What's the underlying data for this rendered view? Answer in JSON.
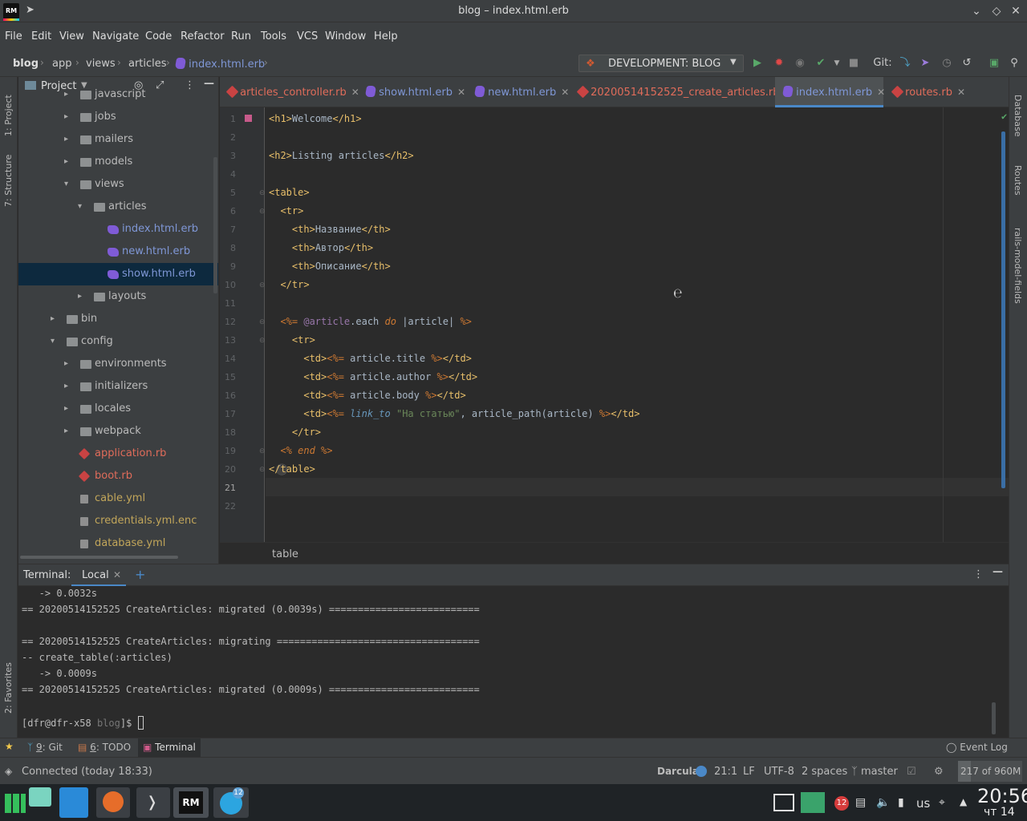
{
  "window": {
    "title": "blog – index.html.erb",
    "app_badge": "RM"
  },
  "menu": [
    "File",
    "Edit",
    "View",
    "Navigate",
    "Code",
    "Refactor",
    "Run",
    "Tools",
    "VCS",
    "Window",
    "Help"
  ],
  "nav": {
    "crumbs": [
      "blog",
      "app",
      "views",
      "articles",
      "index.html.erb"
    ],
    "run_config": "DEVELOPMENT: BLOG",
    "git_label": "Git:"
  },
  "left_stripe": {
    "project_tab": "1: Project",
    "structure_tab": "7: Structure",
    "favorites_tab": "2: Favorites"
  },
  "right_stripe": {
    "database_tab": "Database",
    "routes_tab": "Routes",
    "model_fields_tab": "rails-model-fields"
  },
  "project": {
    "title": "Project",
    "tree": [
      {
        "label": "javascript",
        "kind": "folder",
        "depth": 2,
        "expanded": false
      },
      {
        "label": "jobs",
        "kind": "folder",
        "depth": 2,
        "expanded": false
      },
      {
        "label": "mailers",
        "kind": "folder",
        "depth": 2,
        "expanded": false
      },
      {
        "label": "models",
        "kind": "folder",
        "depth": 2,
        "expanded": false
      },
      {
        "label": "views",
        "kind": "folder",
        "depth": 2,
        "expanded": true
      },
      {
        "label": "articles",
        "kind": "folder",
        "depth": 3,
        "expanded": true
      },
      {
        "label": "index.html.erb",
        "kind": "erb",
        "depth": 4
      },
      {
        "label": "new.html.erb",
        "kind": "erb",
        "depth": 4
      },
      {
        "label": "show.html.erb",
        "kind": "erb",
        "depth": 4,
        "selected": true
      },
      {
        "label": "layouts",
        "kind": "folder",
        "depth": 3,
        "expanded": false
      },
      {
        "label": "bin",
        "kind": "folder",
        "depth": 1,
        "expanded": false
      },
      {
        "label": "config",
        "kind": "folder",
        "depth": 1,
        "expanded": true
      },
      {
        "label": "environments",
        "kind": "folder",
        "depth": 2,
        "expanded": false
      },
      {
        "label": "initializers",
        "kind": "folder",
        "depth": 2,
        "expanded": false
      },
      {
        "label": "locales",
        "kind": "folder",
        "depth": 2,
        "expanded": false
      },
      {
        "label": "webpack",
        "kind": "folder",
        "depth": 2,
        "expanded": false
      },
      {
        "label": "application.rb",
        "kind": "rb",
        "depth": 2
      },
      {
        "label": "boot.rb",
        "kind": "rb",
        "depth": 2
      },
      {
        "label": "cable.yml",
        "kind": "yml",
        "depth": 2
      },
      {
        "label": "credentials.yml.enc",
        "kind": "enc",
        "depth": 2
      },
      {
        "label": "database.yml",
        "kind": "yml",
        "depth": 2
      }
    ]
  },
  "editor_tabs": [
    {
      "label": "articles_controller.rb",
      "kind": "rb"
    },
    {
      "label": "show.html.erb",
      "kind": "erb"
    },
    {
      "label": "new.html.erb",
      "kind": "erb"
    },
    {
      "label": "20200514152525_create_articles.rb",
      "kind": "rb"
    },
    {
      "label": "index.html.erb",
      "kind": "erb",
      "active": true
    },
    {
      "label": "routes.rb",
      "kind": "rb"
    }
  ],
  "editor": {
    "line_numbers": [
      "1",
      "2",
      "3",
      "4",
      "5",
      "6",
      "7",
      "8",
      "9",
      "10",
      "11",
      "12",
      "13",
      "14",
      "15",
      "16",
      "17",
      "18",
      "19",
      "20",
      "21",
      "22"
    ],
    "current_line": "21",
    "lines": [
      [
        [
          "tag",
          "<h1>"
        ],
        [
          "plain",
          "Welcome"
        ],
        [
          "tag",
          "</h1>"
        ]
      ],
      [],
      [
        [
          "tag",
          "<h2>"
        ],
        [
          "plain",
          "Listing articles"
        ],
        [
          "tag",
          "</h2>"
        ]
      ],
      [],
      [
        [
          "tag",
          "<table>"
        ]
      ],
      [
        [
          "plain",
          "  "
        ],
        [
          "tag",
          "<tr>"
        ]
      ],
      [
        [
          "plain",
          "    "
        ],
        [
          "tag",
          "<th>"
        ],
        [
          "plain",
          "Название"
        ],
        [
          "tag",
          "</th>"
        ]
      ],
      [
        [
          "plain",
          "    "
        ],
        [
          "tag",
          "<th>"
        ],
        [
          "plain",
          "Автор"
        ],
        [
          "tag",
          "</th>"
        ]
      ],
      [
        [
          "plain",
          "    "
        ],
        [
          "tag",
          "<th>"
        ],
        [
          "plain",
          "Описание"
        ],
        [
          "tag",
          "</th>"
        ]
      ],
      [
        [
          "plain",
          "  "
        ],
        [
          "tag",
          "</tr>"
        ]
      ],
      [],
      [
        [
          "plain",
          "  "
        ],
        [
          "erbd",
          "<%= "
        ],
        [
          "ivar",
          "@article"
        ],
        [
          "plain",
          ".each "
        ],
        [
          "kw",
          "do"
        ],
        [
          "plain",
          " |article| "
        ],
        [
          "erbd",
          "%>"
        ]
      ],
      [
        [
          "plain",
          "    "
        ],
        [
          "tag",
          "<tr>"
        ]
      ],
      [
        [
          "plain",
          "      "
        ],
        [
          "tag",
          "<td>"
        ],
        [
          "erbd",
          "<%= "
        ],
        [
          "plain",
          "article.title "
        ],
        [
          "erbd",
          "%>"
        ],
        [
          "tag",
          "</td>"
        ]
      ],
      [
        [
          "plain",
          "      "
        ],
        [
          "tag",
          "<td>"
        ],
        [
          "erbd",
          "<%= "
        ],
        [
          "plain",
          "article.author "
        ],
        [
          "erbd",
          "%>"
        ],
        [
          "tag",
          "</td>"
        ]
      ],
      [
        [
          "plain",
          "      "
        ],
        [
          "tag",
          "<td>"
        ],
        [
          "erbd",
          "<%= "
        ],
        [
          "plain",
          "article.body "
        ],
        [
          "erbd",
          "%>"
        ],
        [
          "tag",
          "</td>"
        ]
      ],
      [
        [
          "plain",
          "      "
        ],
        [
          "tag",
          "<td>"
        ],
        [
          "erbd",
          "<%= "
        ],
        [
          "fn",
          "link_to"
        ],
        [
          "plain",
          " "
        ],
        [
          "str",
          "\"На статью\""
        ],
        [
          "plain",
          ", article_path(article) "
        ],
        [
          "erbd",
          "%>"
        ],
        [
          "tag",
          "</td>"
        ]
      ],
      [
        [
          "plain",
          "    "
        ],
        [
          "tag",
          "</tr>"
        ]
      ],
      [
        [
          "plain",
          "  "
        ],
        [
          "erbd",
          "<% "
        ],
        [
          "kw",
          "end"
        ],
        [
          "erbd",
          " %>"
        ]
      ],
      [
        [
          "tag",
          "</table>"
        ]
      ],
      [],
      []
    ],
    "breadcrumb": "table"
  },
  "terminal": {
    "title": "Terminal:",
    "tab": "Local",
    "lines": [
      "   -> 0.0032s",
      "== 20200514152525 CreateArticles: migrated (0.0039s) ==========================",
      "",
      "== 20200514152525 CreateArticles: migrating ===================================",
      "-- create_table(:articles)",
      "   -> 0.0009s",
      "== 20200514152525 CreateArticles: migrated (0.0009s) =========================="
    ],
    "prompt_user": "[dfr@dfr-x58",
    "prompt_dir": "blog",
    "prompt_end": "]$"
  },
  "bottom_tabs": [
    {
      "num": "9",
      "label": ": Git"
    },
    {
      "num": "6",
      "label": ": TODO"
    },
    {
      "num": "",
      "label": "Terminal",
      "active": true
    }
  ],
  "event_log": "Event Log",
  "status": {
    "message": "Connected (today 18:33)",
    "theme": "Darcula",
    "position": "21:1",
    "line_sep": "LF",
    "encoding": "UTF-8",
    "indent": "2 spaces",
    "branch": "master",
    "memory": "217 of 960M"
  },
  "taskbar": {
    "notification_badge": "12",
    "telegram_badge": "12",
    "keyboard_layout": "us",
    "clock_time": "20:56",
    "clock_day": "чт 14"
  },
  "colors": {
    "accent": "#4a88c7",
    "selection": "#0d293e",
    "background": "#2b2b2b"
  }
}
